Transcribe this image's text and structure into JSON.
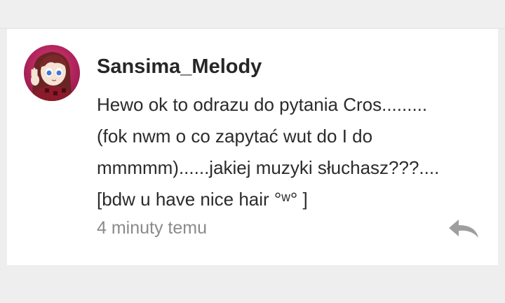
{
  "comment": {
    "username": "Sansima_Melody",
    "message_lines": [
      "Hewo ok to odrazu do pytania Cros.........",
      "(fok nwm o co zapytać wut do I do",
      "mmmmm)......jakiej muzyki słuchasz???....",
      "[bdw u have nice hair °ʷ° ]"
    ],
    "timestamp": "4 minuty temu",
    "avatar_icon": "anime-girl-avatar",
    "reply_icon": "reply-arrow-icon"
  },
  "colors": {
    "avatar_ring": "#c2185b",
    "avatar_hair": "#7a2a2a",
    "timestamp": "#8a8a8a",
    "reply_icon": "#9e9e9e"
  }
}
